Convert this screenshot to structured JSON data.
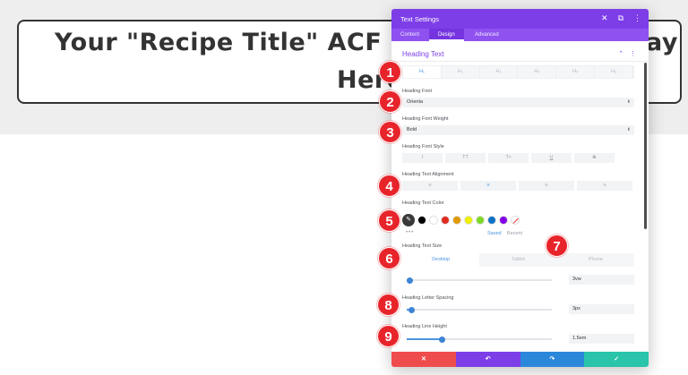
{
  "page": {
    "heading_line1": "Your \"Recipe Title\" ACF Fie",
    "heading_line1_right": "ay",
    "heading_line2": "Here"
  },
  "panel": {
    "title": "Text Settings",
    "header_icons": [
      "close-icon",
      "expand-icon",
      "more-icon"
    ],
    "header_glyphs": {
      "close": "✕",
      "expand": "⧉",
      "more": "⋮"
    },
    "tabs": [
      {
        "label": "Content",
        "active": false
      },
      {
        "label": "Design",
        "active": true
      },
      {
        "label": "Advanced",
        "active": false
      }
    ],
    "section": {
      "title": "Heading Text",
      "collapse_glyph": "⌃",
      "more_glyph": "⋮"
    },
    "heading_levels": [
      {
        "label": "H₁",
        "active": true
      },
      {
        "label": "H₂",
        "active": false
      },
      {
        "label": "H₃",
        "active": false
      },
      {
        "label": "H₄",
        "active": false
      },
      {
        "label": "H₅",
        "active": false
      },
      {
        "label": "H₆",
        "active": false
      }
    ],
    "font": {
      "label": "Heading Font",
      "value": "Orienta"
    },
    "weight": {
      "label": "Heading Font Weight",
      "value": "Bold"
    },
    "style": {
      "label": "Heading Font Style",
      "buttons": [
        "I",
        "TT",
        "Tт",
        "U",
        "S"
      ]
    },
    "alignment": {
      "label": "Heading Text Alignment",
      "buttons": [
        "≡",
        "≡",
        "≡",
        "≡"
      ],
      "active_index": 1
    },
    "color": {
      "label": "Heading Text Color",
      "picker_glyph": "✎",
      "swatches": [
        "#000000",
        "#ffffff",
        "#e02b20",
        "#e09900",
        "#edf000",
        "#7cda24",
        "#0c71c3",
        "#8300e9"
      ],
      "dots": "•••",
      "saved_label": "Saved",
      "recent_label": "Recent"
    },
    "size": {
      "label": "Heading Text Size",
      "devices": [
        {
          "label": "Desktop",
          "active": true
        },
        {
          "label": "Tablet",
          "active": false
        },
        {
          "label": "Phone",
          "active": false
        }
      ],
      "value": "3vw",
      "slider_fraction": 0.02
    },
    "letter_spacing": {
      "label": "Heading Letter Spacing",
      "value": "3px",
      "slider_fraction": 0.03
    },
    "line_height": {
      "label": "Heading Line Height",
      "value": "1.5em",
      "slider_fraction": 0.24
    },
    "footer": [
      {
        "name": "discard-button",
        "glyph": "✕",
        "color": "#ef4d4d"
      },
      {
        "name": "undo-button",
        "glyph": "↶",
        "color": "#7d3ee8"
      },
      {
        "name": "redo-button",
        "glyph": "↷",
        "color": "#2b87da"
      },
      {
        "name": "save-button",
        "glyph": "✓",
        "color": "#29c4a9"
      }
    ]
  },
  "badges": [
    "1",
    "2",
    "3",
    "4",
    "5",
    "6",
    "7",
    "8",
    "9"
  ],
  "colors": {
    "accent": "#7d3ee8",
    "badge": "#e8242b",
    "link_blue": "#4b93e0"
  }
}
